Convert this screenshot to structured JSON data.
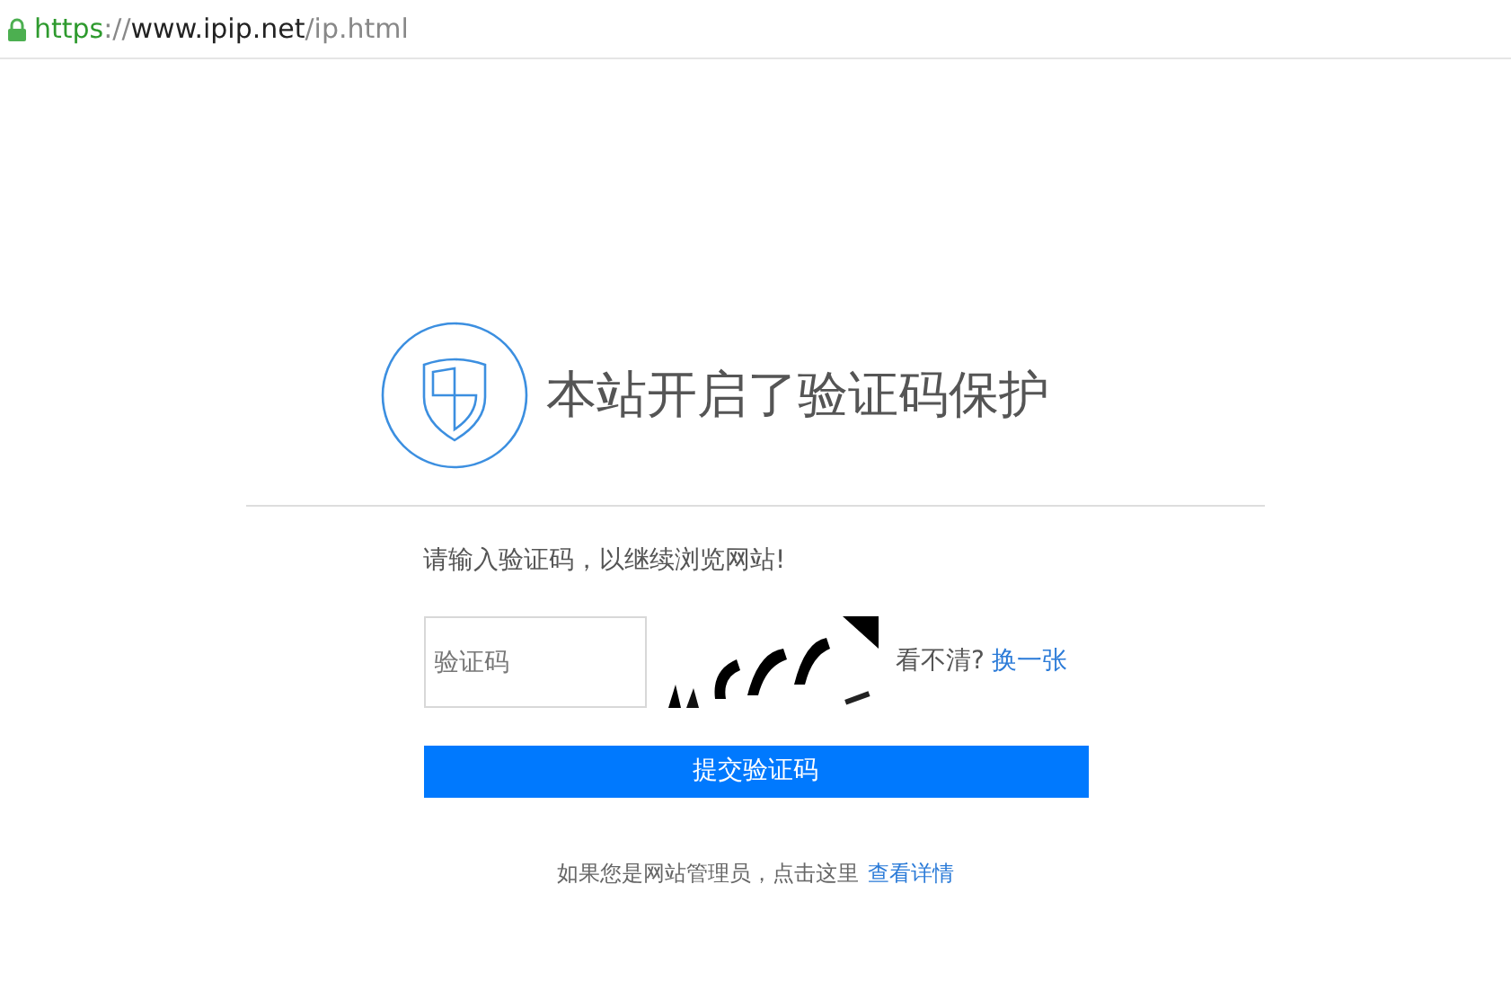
{
  "address_bar": {
    "secure": true,
    "scheme": "https",
    "separator": "://",
    "host": "www.ipip.net",
    "path": "/ip.html"
  },
  "heading": {
    "title": "本站开启了验证码保护"
  },
  "prompt": "请输入验证码，以继续浏览网站!",
  "captcha_field": {
    "placeholder": "验证码"
  },
  "refresh": {
    "label": "看不清?",
    "link": "换一张"
  },
  "submit_button": "提交验证码",
  "footer": {
    "text": "如果您是网站管理员，点击这里",
    "link": "查看详情"
  }
}
